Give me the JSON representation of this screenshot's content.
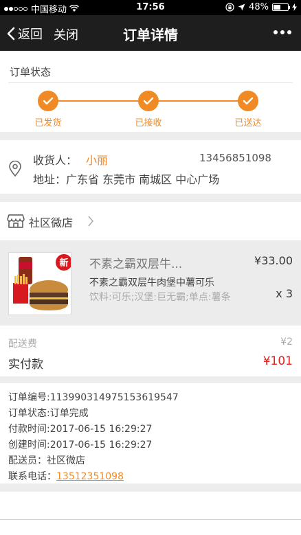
{
  "status_bar": {
    "carrier": "中国移动",
    "time": "17:56",
    "battery": "48%"
  },
  "nav": {
    "back_label": "返回",
    "close_label": "关闭",
    "title": "订单详情"
  },
  "order_status": {
    "title": "订单状态",
    "steps": [
      {
        "label": "已发货"
      },
      {
        "label": "已接收"
      },
      {
        "label": "已送达"
      }
    ]
  },
  "address": {
    "receiver_label": "收货人：",
    "receiver_name": "小丽",
    "phone": "13456851098",
    "address_text": "地址：广东省 东莞市 南城区 中心广场"
  },
  "shop": {
    "name": "社区微店"
  },
  "product": {
    "badge": "新",
    "name": "不素之霸双层牛...",
    "price": "¥33.00",
    "description": "不素之霸双层牛肉堡中薯可乐",
    "spec": "饮料:可乐;汉堡:巨无霸;单点:薯条",
    "quantity": "x 3"
  },
  "fees": {
    "delivery_label": "配送费",
    "delivery_value": "¥2",
    "paid_label": "实付款",
    "paid_value": "¥101"
  },
  "info": {
    "order_no": "订单编号:113990314975153619547",
    "order_status": "订单状态:订单完成",
    "pay_time": "付款时间:2017-06-15 16:29:27",
    "create_time": "创建时间:2017-06-15 16:29:27",
    "courier": "配送员：社区微店",
    "contact_label": "联系电话：",
    "contact_phone": "13512351098"
  },
  "colors": {
    "accent": "#f08a24",
    "price_red": "#e02020",
    "nav_bg": "#1e1e1e"
  }
}
